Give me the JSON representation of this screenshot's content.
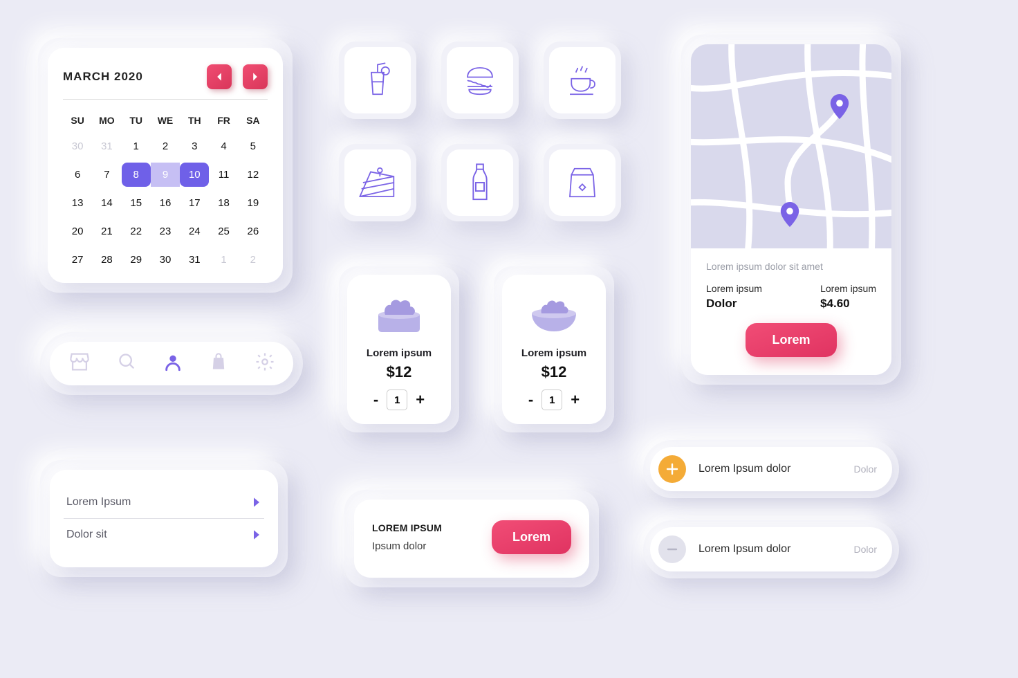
{
  "calendar": {
    "title": "MARCH 2020",
    "dow": [
      "SU",
      "MO",
      "TU",
      "WE",
      "TH",
      "FR",
      "SA"
    ],
    "days": [
      {
        "n": 30,
        "muted": true
      },
      {
        "n": 31,
        "muted": true
      },
      {
        "n": 1
      },
      {
        "n": 2
      },
      {
        "n": 3
      },
      {
        "n": 4
      },
      {
        "n": 5
      },
      {
        "n": 6
      },
      {
        "n": 7
      },
      {
        "n": 8,
        "sel": "start"
      },
      {
        "n": 9,
        "sel": "mid"
      },
      {
        "n": 10,
        "sel": "end"
      },
      {
        "n": 11
      },
      {
        "n": 12
      },
      {
        "n": 13
      },
      {
        "n": 14
      },
      {
        "n": 15
      },
      {
        "n": 16
      },
      {
        "n": 17
      },
      {
        "n": 18
      },
      {
        "n": 19
      },
      {
        "n": 20
      },
      {
        "n": 21
      },
      {
        "n": 22
      },
      {
        "n": 23
      },
      {
        "n": 24
      },
      {
        "n": 25
      },
      {
        "n": 26
      },
      {
        "n": 27
      },
      {
        "n": 28
      },
      {
        "n": 29
      },
      {
        "n": 30
      },
      {
        "n": 31
      },
      {
        "n": 1,
        "muted": true
      },
      {
        "n": 2,
        "muted": true
      }
    ]
  },
  "nav": {
    "items": [
      {
        "name": "store-icon",
        "active": false
      },
      {
        "name": "search-icon",
        "active": false
      },
      {
        "name": "user-icon",
        "active": true
      },
      {
        "name": "bag-icon",
        "active": false
      },
      {
        "name": "gear-icon",
        "active": false
      }
    ]
  },
  "list": {
    "rows": [
      {
        "label": "Lorem Ipsum"
      },
      {
        "label": "Dolor sit"
      }
    ]
  },
  "categories": [
    {
      "name": "drink-icon"
    },
    {
      "name": "burger-icon"
    },
    {
      "name": "coffee-icon"
    },
    {
      "name": "cake-icon"
    },
    {
      "name": "bottle-icon"
    },
    {
      "name": "bag-food-icon"
    }
  ],
  "products": [
    {
      "name": "Lorem ipsum",
      "price": "$12",
      "qty": "1",
      "icon": "salad-box"
    },
    {
      "name": "Lorem ipsum",
      "price": "$12",
      "qty": "1",
      "icon": "salad-bowl"
    }
  ],
  "banner": {
    "title": "LOREM IPSUM",
    "sub": "Ipsum dolor",
    "cta": "Lorem"
  },
  "map": {
    "caption": "Lorem ipsum dolor sit amet",
    "stat1_label": "Lorem ipsum",
    "stat1_value": "Dolor",
    "stat2_label": "Lorem ipsum",
    "stat2_value": "$4.60",
    "cta": "Lorem"
  },
  "actions": [
    {
      "title": "Lorem Ipsum dolor",
      "note": "Dolor",
      "type": "plus"
    },
    {
      "title": "Lorem Ipsum dolor",
      "note": "Dolor",
      "type": "minus"
    }
  ],
  "symbols": {
    "minus": "-",
    "plus": "+"
  },
  "colors": {
    "purple": "#7a63e6",
    "pink": "#e8436d",
    "orange": "#f4ab37"
  }
}
